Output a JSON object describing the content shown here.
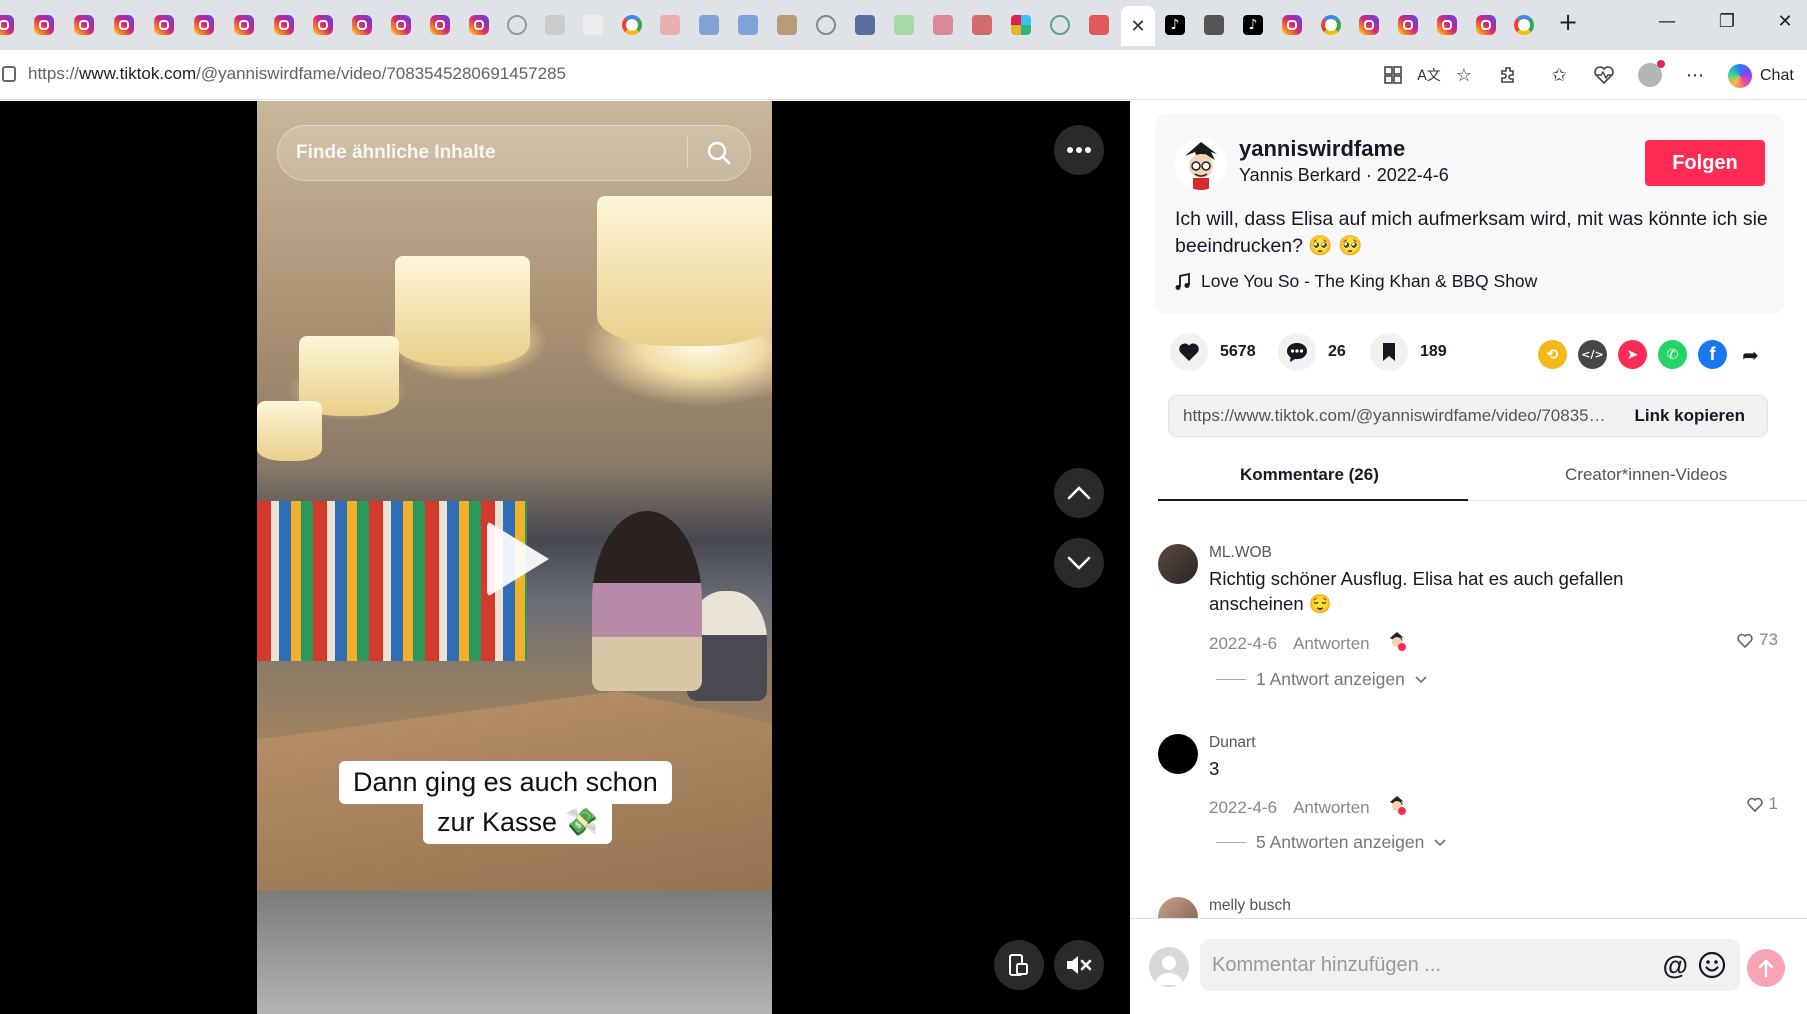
{
  "browser": {
    "url_prefix": "https://",
    "url_domain": "www.tiktok.com",
    "url_path": "/@yanniswirdfame/video/7083545280691457285",
    "chat_label": "Chat",
    "tab_close_glyph": "✕",
    "new_tab_glyph": "+",
    "window_controls": [
      "—",
      "❐",
      "✕"
    ]
  },
  "video": {
    "search_placeholder": "Finde ähnliche Inhalte",
    "caption_line1": "Dann ging es auch schon",
    "caption_line2": "zur Kasse 💸"
  },
  "post": {
    "username": "yanniswirdfame",
    "display_name": "Yannis Berkard",
    "date": "2022-4-6",
    "subline_separator": " · ",
    "follow_label": "Folgen",
    "description": "Ich will, dass Elisa auf mich aufmerksam wird, mit was könnte ich sie beeindrucken? 🥺 🥺",
    "music": "Love You So - The King Khan & BBQ Show",
    "likes": "5678",
    "comments": "26",
    "saves": "189",
    "link_url": "https://www.tiktok.com/@yanniswirdfame/video/7083545280691457285",
    "link_copy_label": "Link kopieren"
  },
  "tabs": {
    "comments_label": "Kommentare (26)",
    "creator_videos_label": "Creator*innen-Videos"
  },
  "comments": [
    {
      "name": "ML.WOB",
      "text": "Richtig schöner Ausflug. Elisa hat es auch gefallen anscheinen 😌",
      "date": "2022-4-6",
      "reply_label": "Antworten",
      "likes": "73",
      "replies_label": "1 Antwort anzeigen"
    },
    {
      "name": "Dunart",
      "text": "3",
      "date": "2022-4-6",
      "reply_label": "Antworten",
      "likes": "1",
      "replies_label": "5 Antworten anzeigen"
    },
    {
      "name": "melly busch"
    }
  ],
  "composer": {
    "placeholder": "Kommentar hinzufügen ...",
    "mention_glyph": "@"
  },
  "colors": {
    "accent": "#fe2c55",
    "send_disabled": "#f7a5b5"
  }
}
